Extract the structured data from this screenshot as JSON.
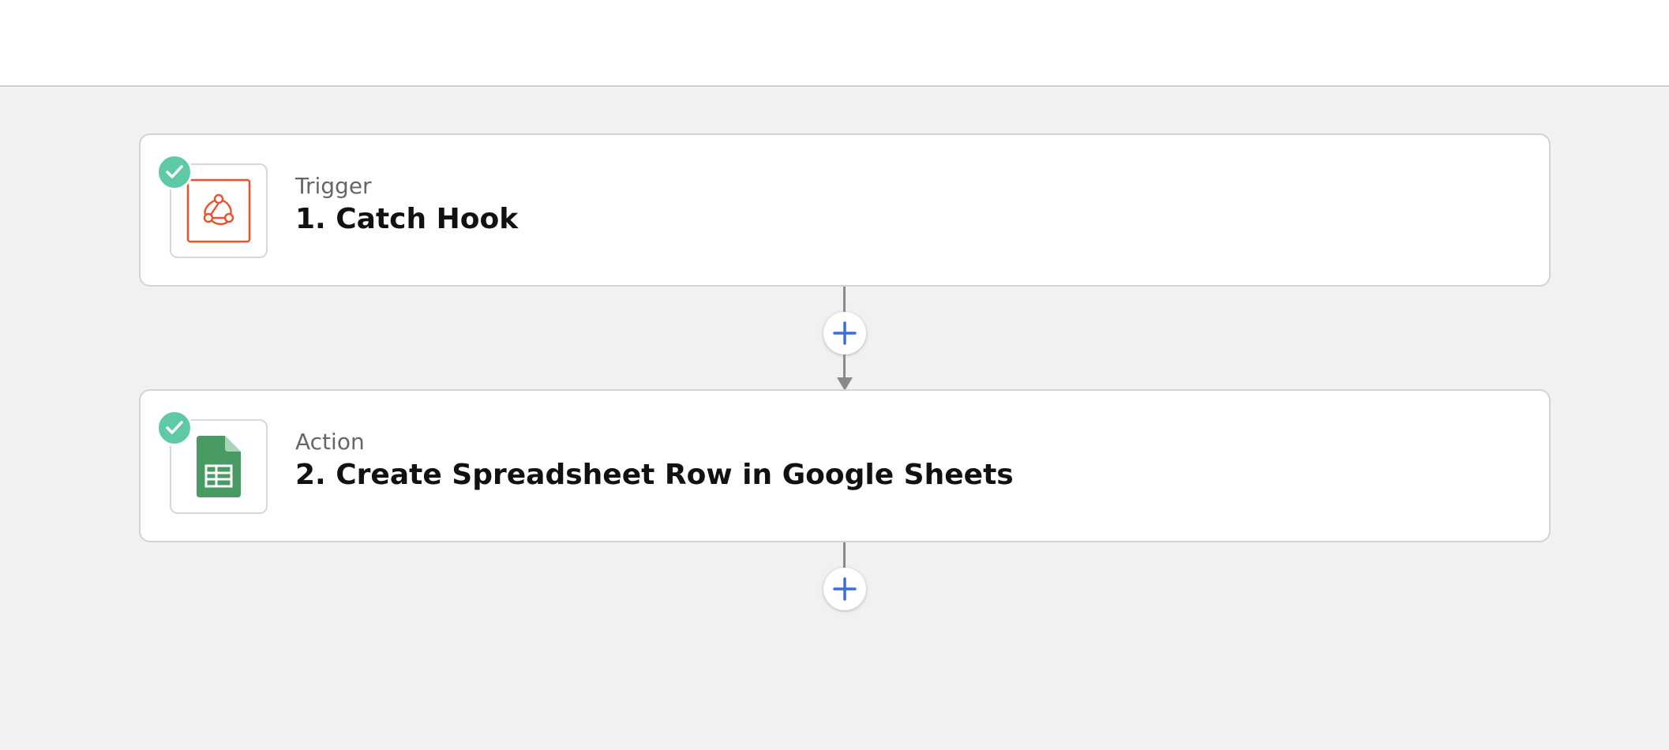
{
  "steps": [
    {
      "type_label": "Trigger",
      "title": "1. Catch Hook",
      "app_icon": "webhook-icon",
      "status_icon": "check-icon"
    },
    {
      "type_label": "Action",
      "title": "2. Create Spreadsheet Row in Google Sheets",
      "app_icon": "google-sheets-icon",
      "status_icon": "check-icon"
    }
  ],
  "add_step_icon": "plus-icon",
  "colors": {
    "background": "#f1f1f1",
    "card": "#ffffff",
    "success": "#5ec9a7",
    "webhook": "#e8532b",
    "sheets": "#4a9a63",
    "accent_blue": "#3b6fd8",
    "connector": "#8a8a8a"
  }
}
